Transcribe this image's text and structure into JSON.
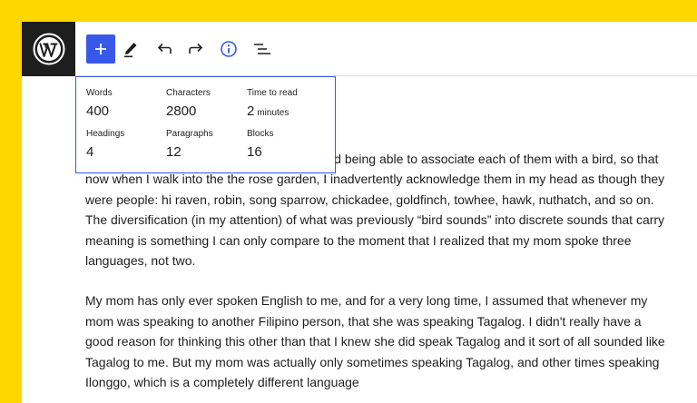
{
  "toolbar": {
    "logo": "wordpress-logo",
    "buttons": [
      "add-block",
      "edit-tools",
      "undo",
      "redo",
      "details",
      "list-view"
    ]
  },
  "info_panel": {
    "words": {
      "label": "Words",
      "value": "400"
    },
    "characters": {
      "label": "Characters",
      "value": "2800"
    },
    "time_to_read": {
      "label": "Time to read",
      "value": "2",
      "unit": "minutes"
    },
    "headings": {
      "label": "Headings",
      "value": "4"
    },
    "paragraphs": {
      "label": "Paragraphs",
      "value": "12"
    },
    "blocks": {
      "label": "Blocks",
      "value": "16"
    }
  },
  "content": {
    "paragraph_1": "er songs and being able to associate each of them with a bird, so that now when I walk into the the rose garden, I inadvertently acknowledge them in my head as though they were people: hi raven, robin, song sparrow, chickadee, goldfinch, towhee, hawk, nuthatch, and so on. The diversification (in my attention) of what was previously “bird sounds” into discrete sounds that carry meaning is something I can only compare to the moment that I realized that my mom spoke three languages, not two.",
    "paragraph_2": "My mom has only ever spoken English to me, and for a very long time, I assumed that whenever my mom was speaking to another Filipino person, that she was speaking Tagalog. I didn't really have a good reason for thinking this other than that I knew she did speak Tagalog and it sort of all sounded like Tagalog to me. But my mom was actually only sometimes speaking Tagalog, and other times speaking Ilonggo, which is a completely different language"
  },
  "colors": {
    "background": "#ffd700",
    "accent": "#3858e9",
    "logo_bg": "#1e1e1e"
  }
}
